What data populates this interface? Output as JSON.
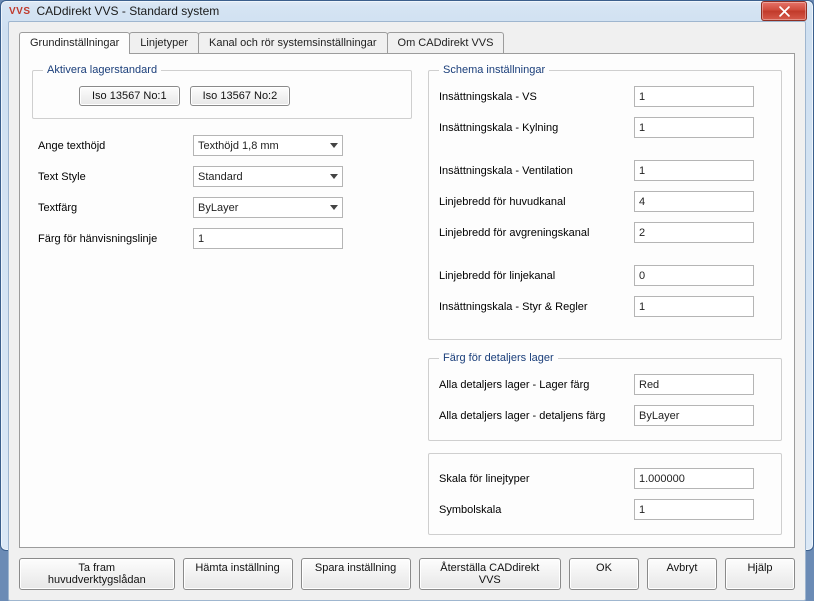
{
  "window": {
    "app_icon_text": "VVS",
    "title": "CADdirekt VVS - Standard system"
  },
  "tabs": [
    {
      "label": "Grundinställningar"
    },
    {
      "label": "Linjetyper"
    },
    {
      "label": "Kanal och rör systemsinställningar"
    },
    {
      "label": "Om CADdirekt VVS"
    }
  ],
  "layerstd": {
    "legend": "Aktivera lagerstandard",
    "btn1": "Iso 13567 No:1",
    "btn2": "Iso 13567 No:2"
  },
  "leftform": {
    "row_textheight_label": "Ange texthöjd",
    "row_textheight_value": "Texthöjd 1,8 mm",
    "row_textstyle_label": "Text Style",
    "row_textstyle_value": "Standard",
    "row_textcolor_label": "Textfärg",
    "row_textcolor_value": "ByLayer",
    "row_refcolor_label": "Färg för hänvisningslinje",
    "row_refcolor_value": "1"
  },
  "schema": {
    "legend": "Schema inställningar",
    "rows": [
      {
        "label": "Insättningskala - VS",
        "value": "1"
      },
      {
        "label": "Insättningskala - Kylning",
        "value": "1"
      },
      {
        "label": "Insättningskala - Ventilation",
        "value": "1"
      },
      {
        "label": "Linjebredd för huvudkanal",
        "value": "4"
      },
      {
        "label": "Linjebredd för avgreningskanal",
        "value": "2"
      },
      {
        "label": "Linjebredd för linjekanal",
        "value": "0"
      },
      {
        "label": "Insättningskala - Styr & Regler",
        "value": "1"
      }
    ]
  },
  "detailcolors": {
    "legend": "Färg för detaljers lager",
    "row1_label": "Alla detaljers lager - Lager färg",
    "row1_value": "Red",
    "row2_label": "Alla detaljers lager - detaljens färg",
    "row2_value": "ByLayer"
  },
  "scales": {
    "row1_label": "Skala för linejtyper",
    "row1_value": "1.000000",
    "row2_label": "Symbolskala",
    "row2_value": "1"
  },
  "footer": {
    "btn_main_toolbox": "Ta fram huvudverktygslådan",
    "btn_load": "Hämta inställning",
    "btn_save": "Spara inställning",
    "btn_reset": "Återställa CADdirekt VVS",
    "btn_ok": "OK",
    "btn_cancel": "Avbryt",
    "btn_help": "Hjälp"
  }
}
